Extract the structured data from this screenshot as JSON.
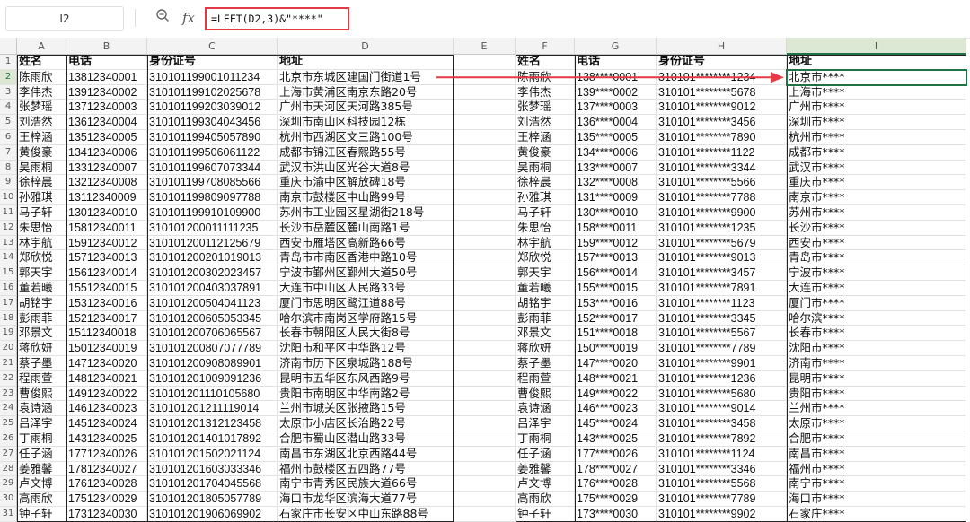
{
  "formula_bar": {
    "name_box": "I2",
    "zoom_icon": "zoom-icon",
    "fx_label": "fx",
    "formula": "=LEFT(D2,3)&\"****\""
  },
  "columns": [
    "A",
    "B",
    "C",
    "D",
    "E",
    "F",
    "G",
    "H",
    "I"
  ],
  "selected_cell": {
    "column": "I",
    "row": 2
  },
  "accent_colors": {
    "selection": "#217346",
    "highlight": "#e63946"
  },
  "left_table": {
    "headers": [
      "姓名",
      "电话",
      "身份证号",
      "地址"
    ],
    "rows": [
      [
        "陈雨欣",
        "13812340001",
        "310101199001011234",
        "北京市东城区建国门街道1号"
      ],
      [
        "李伟杰",
        "13912340002",
        "310101199102025678",
        "上海市黄浦区南京东路20号"
      ],
      [
        "张梦瑶",
        "13712340003",
        "310101199203039012",
        "广州市天河区天河路385号"
      ],
      [
        "刘浩然",
        "13612340004",
        "310101199304043456",
        "深圳市南山区科技园12栋"
      ],
      [
        "王梓涵",
        "13512340005",
        "310101199405057890",
        "杭州市西湖区文三路100号"
      ],
      [
        "黄俊豪",
        "13412340006",
        "310101199506061122",
        "成都市锦江区春熙路55号"
      ],
      [
        "吴雨桐",
        "13312340007",
        "310101199607073344",
        "武汉市洪山区光谷大道8号"
      ],
      [
        "徐梓晨",
        "13212340008",
        "310101199708085566",
        "重庆市渝中区解放碑18号"
      ],
      [
        "孙雅琪",
        "13112340009",
        "310101199809097788",
        "南京市鼓楼区中山路99号"
      ],
      [
        "马子轩",
        "13012340010",
        "310101199910109900",
        "苏州市工业园区星湖街218号"
      ],
      [
        "朱思怡",
        "15812340011",
        "310101200011111235",
        "长沙市岳麓区麓山南路1号"
      ],
      [
        "林宇航",
        "15912340012",
        "310101200112125679",
        "西安市雁塔区高新路66号"
      ],
      [
        "郑欣悦",
        "15712340013",
        "310101200201019013",
        "青岛市市南区香港中路10号"
      ],
      [
        "郭天宇",
        "15612340014",
        "310101200302023457",
        "宁波市鄞州区鄞州大道50号"
      ],
      [
        "董若曦",
        "15512340015",
        "310101200403037891",
        "大连市中山区人民路33号"
      ],
      [
        "胡铭宇",
        "15312340016",
        "310101200504041123",
        "厦门市思明区鹭江道88号"
      ],
      [
        "彭雨菲",
        "15212340017",
        "310101200605053345",
        "哈尔滨市南岗区学府路15号"
      ],
      [
        "邓景文",
        "15112340018",
        "310101200706065567",
        "长春市朝阳区人民大街8号"
      ],
      [
        "蒋欣妍",
        "15012340019",
        "310101200807077789",
        "沈阳市和平区中华路12号"
      ],
      [
        "蔡子墨",
        "14712340020",
        "310101200908089901",
        "济南市历下区泉城路188号"
      ],
      [
        "程雨萱",
        "14812340021",
        "310101201009091236",
        "昆明市五华区东风西路9号"
      ],
      [
        "曹俊熙",
        "14912340022",
        "310101201110105680",
        "贵阳市南明区中华南路2号"
      ],
      [
        "袁诗涵",
        "14612340023",
        "310101201211119014",
        "兰州市城关区张掖路15号"
      ],
      [
        "吕泽宇",
        "14512340024",
        "310101201312123458",
        "太原市小店区长治路22号"
      ],
      [
        "丁雨桐",
        "14312340025",
        "310101201401017892",
        "合肥市蜀山区潜山路33号"
      ],
      [
        "任子涵",
        "17712340026",
        "310101201502021124",
        "南昌市东湖区北京西路44号"
      ],
      [
        "姜雅馨",
        "17812340027",
        "310101201603033346",
        "福州市鼓楼区五四路77号"
      ],
      [
        "卢文博",
        "17612340028",
        "310101201704045568",
        "南宁市青秀区民族大道66号"
      ],
      [
        "高雨欣",
        "17512340029",
        "310101201805057789",
        "海口市龙华区滨海大道77号"
      ],
      [
        "钟子轩",
        "17312340030",
        "310101201906069902",
        "石家庄市长安区中山东路88号"
      ]
    ]
  },
  "right_table": {
    "headers": [
      "姓名",
      "电话",
      "身份证号",
      "地址"
    ],
    "rows": [
      [
        "陈雨欣",
        "138****0001",
        "310101********1234",
        "北京市****"
      ],
      [
        "李伟杰",
        "139****0002",
        "310101********5678",
        "上海市****"
      ],
      [
        "张梦瑶",
        "137****0003",
        "310101********9012",
        "广州市****"
      ],
      [
        "刘浩然",
        "136****0004",
        "310101********3456",
        "深圳市****"
      ],
      [
        "王梓涵",
        "135****0005",
        "310101********7890",
        "杭州市****"
      ],
      [
        "黄俊豪",
        "134****0006",
        "310101********1122",
        "成都市****"
      ],
      [
        "吴雨桐",
        "133****0007",
        "310101********3344",
        "武汉市****"
      ],
      [
        "徐梓晨",
        "132****0008",
        "310101********5566",
        "重庆市****"
      ],
      [
        "孙雅琪",
        "131****0009",
        "310101********7788",
        "南京市****"
      ],
      [
        "马子轩",
        "130****0010",
        "310101********9900",
        "苏州市****"
      ],
      [
        "朱思怡",
        "158****0011",
        "310101********1235",
        "长沙市****"
      ],
      [
        "林宇航",
        "159****0012",
        "310101********5679",
        "西安市****"
      ],
      [
        "郑欣悦",
        "157****0013",
        "310101********9013",
        "青岛市****"
      ],
      [
        "郭天宇",
        "156****0014",
        "310101********3457",
        "宁波市****"
      ],
      [
        "董若曦",
        "155****0015",
        "310101********7891",
        "大连市****"
      ],
      [
        "胡铭宇",
        "153****0016",
        "310101********1123",
        "厦门市****"
      ],
      [
        "彭雨菲",
        "152****0017",
        "310101********3345",
        "哈尔滨****"
      ],
      [
        "邓景文",
        "151****0018",
        "310101********5567",
        "长春市****"
      ],
      [
        "蒋欣妍",
        "150****0019",
        "310101********7789",
        "沈阳市****"
      ],
      [
        "蔡子墨",
        "147****0020",
        "310101********9901",
        "济南市****"
      ],
      [
        "程雨萱",
        "148****0021",
        "310101********1236",
        "昆明市****"
      ],
      [
        "曹俊熙",
        "149****0022",
        "310101********5680",
        "贵阳市****"
      ],
      [
        "袁诗涵",
        "146****0023",
        "310101********9014",
        "兰州市****"
      ],
      [
        "吕泽宇",
        "145****0024",
        "310101********3458",
        "太原市****"
      ],
      [
        "丁雨桐",
        "143****0025",
        "310101********7892",
        "合肥市****"
      ],
      [
        "任子涵",
        "177****0026",
        "310101********1124",
        "南昌市****"
      ],
      [
        "姜雅馨",
        "178****0027",
        "310101********3346",
        "福州市****"
      ],
      [
        "卢文博",
        "176****0028",
        "310101********5568",
        "南宁市****"
      ],
      [
        "高雨欣",
        "175****0029",
        "310101********7789",
        "海口市****"
      ],
      [
        "钟子轩",
        "173****0030",
        "310101********9902",
        "石家庄****"
      ]
    ]
  }
}
